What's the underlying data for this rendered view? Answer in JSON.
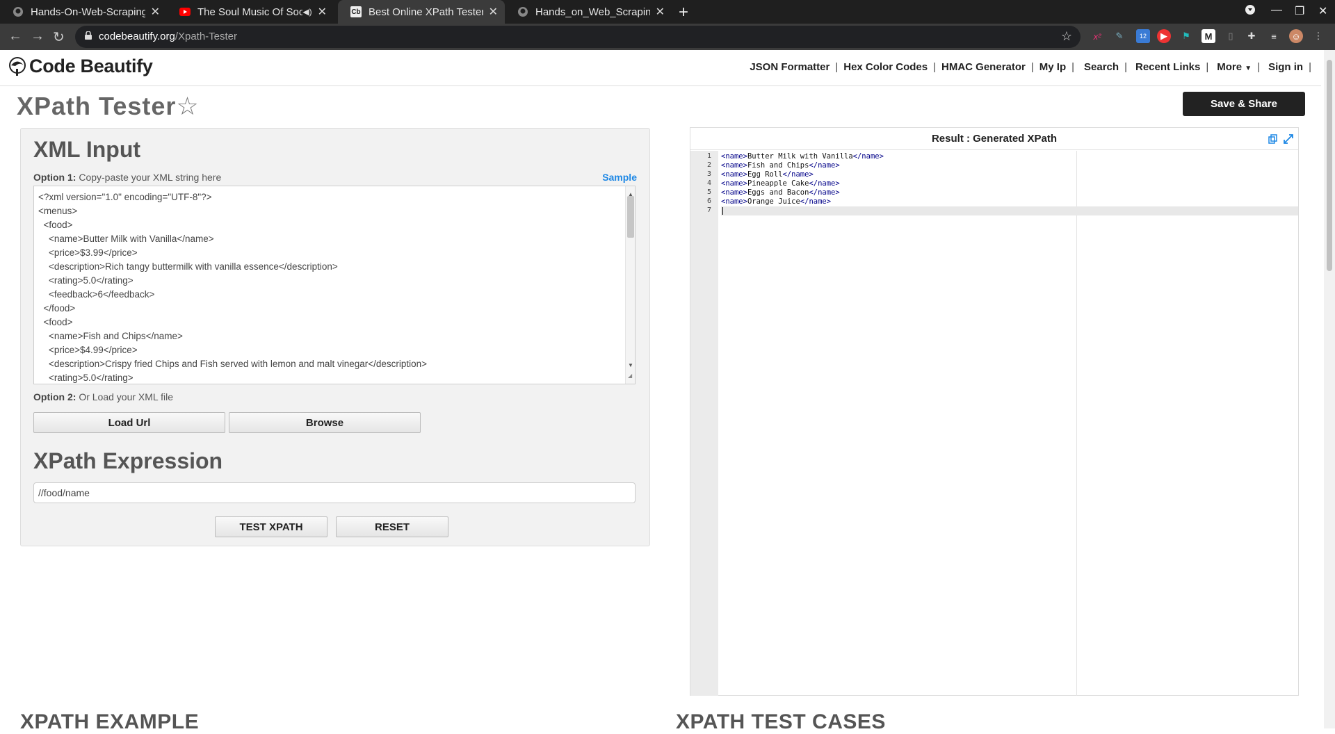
{
  "browser": {
    "tabs": [
      {
        "title": "Hands-On-Web-Scraping-",
        "icon": "github-icon"
      },
      {
        "title": "The Soul Music Of Soo",
        "icon": "youtube-icon"
      },
      {
        "title": "Best Online XPath Tester",
        "icon": "codebeautify-icon",
        "active": true
      },
      {
        "title": "Hands_on_Web_Scraping",
        "icon": "github-icon"
      }
    ],
    "url_domain": "codebeautify.org",
    "url_path": "/Xpath-Tester",
    "ext_badge": "12"
  },
  "header": {
    "logo_text": "Code Beautify",
    "nav": [
      "JSON Formatter",
      "Hex Color Codes",
      "HMAC Generator",
      "My Ip",
      "Search",
      "Recent Links",
      "More",
      "Sign in"
    ]
  },
  "page": {
    "title": "XPath Tester",
    "star": "☆",
    "save_share": "Save & Share"
  },
  "xml_input": {
    "heading": "XML Input",
    "option1_label": "Option 1:",
    "option1_text": "Copy-paste your XML string here",
    "sample": "Sample",
    "lines": [
      "<?xml version=\"1.0\" encoding=\"UTF-8\"?>",
      "<menus>",
      "  <food>",
      "    <name>Butter Milk with Vanilla</name>",
      "    <price>$3.99</price>",
      "    <description>Rich tangy buttermilk with vanilla essence</description>",
      "    <rating>5.0</rating>",
      "    <feedback>6</feedback>",
      "  </food>",
      "  <food>",
      "    <name>Fish and Chips</name>",
      "    <price>$4.99</price>",
      "    <description>Crispy fried Chips and Fish served with lemon and malt vinegar</description>",
      "    <rating>5.0</rating>"
    ],
    "option2_label": "Option 2:",
    "option2_text": "Or Load your XML file",
    "load_url": "Load Url",
    "browse": "Browse"
  },
  "xpath": {
    "heading": "XPath Expression",
    "value": "//food/name",
    "test_button": "TEST XPATH",
    "reset_button": "RESET"
  },
  "result": {
    "title": "Result : Generated XPath",
    "lines": [
      {
        "num": "1",
        "value": "Butter Milk with Vanilla"
      },
      {
        "num": "2",
        "value": "Fish and Chips"
      },
      {
        "num": "3",
        "value": "Egg Roll"
      },
      {
        "num": "4",
        "value": "Pineapple Cake"
      },
      {
        "num": "5",
        "value": "Eggs and Bacon"
      },
      {
        "num": "6",
        "value": "Orange Juice"
      }
    ],
    "open_tag": "<name>",
    "close_tag": "</name>",
    "last_line_num": "7"
  },
  "bottom": {
    "left_heading": "XPATH EXAMPLE",
    "right_heading": "XPATH TEST CASES"
  },
  "colors": {
    "accent_link": "#1e88e5",
    "save_button": "#222222"
  }
}
